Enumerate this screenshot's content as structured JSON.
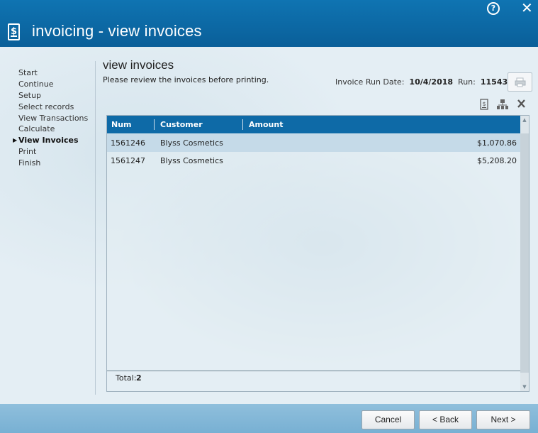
{
  "window": {
    "title": "invoicing - view invoices",
    "help_icon": "?",
    "close_icon": "✕"
  },
  "nav": {
    "items": [
      {
        "label": "Start",
        "active": false
      },
      {
        "label": "Continue",
        "active": false
      },
      {
        "label": "Setup",
        "active": false
      },
      {
        "label": "Select records",
        "active": false
      },
      {
        "label": "View Transactions",
        "active": false
      },
      {
        "label": "Calculate",
        "active": false
      },
      {
        "label": "View Invoices",
        "active": true
      },
      {
        "label": "Print",
        "active": false
      },
      {
        "label": "Finish",
        "active": false
      }
    ]
  },
  "main": {
    "heading": "view invoices",
    "subheading": "Please review the invoices before printing.",
    "run_date_label": "Invoice Run Date:",
    "run_date_value": "10/4/2018",
    "run_label": "Run:",
    "run_value": "11543"
  },
  "toolbar": {
    "icons": [
      "invoice-icon",
      "organization-icon",
      "delete-icon"
    ]
  },
  "grid": {
    "columns": [
      "Num",
      "Customer",
      "Amount"
    ],
    "rows": [
      {
        "num": "1561246",
        "customer": "Blyss Cosmetics",
        "amount": "$1,070.86",
        "selected": true
      },
      {
        "num": "1561247",
        "customer": "Blyss Cosmetics",
        "amount": "$5,208.20",
        "selected": false
      }
    ],
    "total_label": "Total:",
    "total_value": "2"
  },
  "buttons": {
    "cancel": "Cancel",
    "back": "< Back",
    "next": "Next >"
  },
  "colors": {
    "title_bar": "#0f74b2",
    "grid_header": "#0e6aa7",
    "selected_row": "#c5dae8",
    "bottom_bar": "#84b8d8"
  }
}
